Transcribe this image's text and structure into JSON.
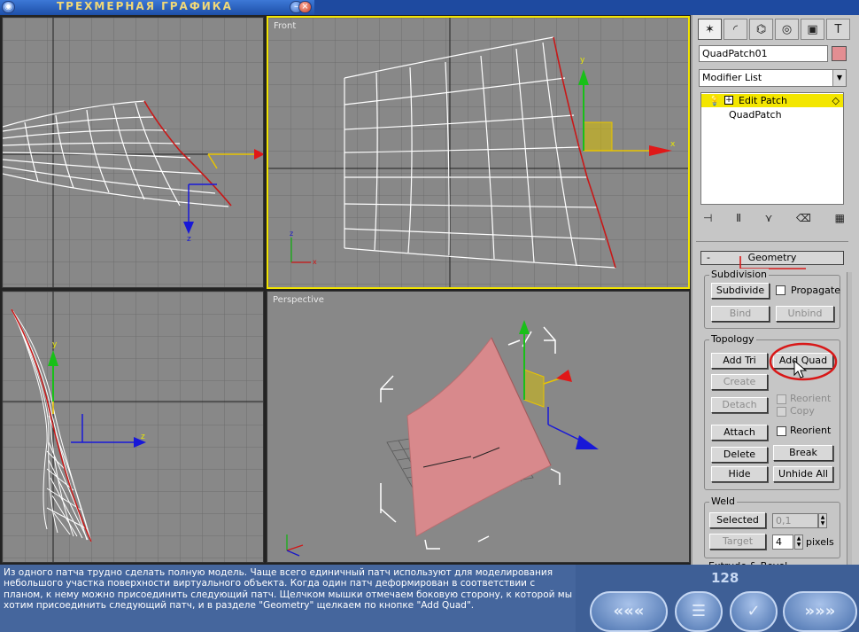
{
  "title_bar": {
    "title": "ТРЕХМЕРНАЯ ГРАФИКА",
    "minimize_label": "–",
    "close_label": "×"
  },
  "viewports": {
    "top_left": {
      "label": ""
    },
    "front": {
      "label": "Front",
      "axis_x": "x",
      "axis_y": "y",
      "axis_z": "z"
    },
    "left": {
      "label": "",
      "axis_y": "y",
      "axis_z": "z"
    },
    "perspective": {
      "label": "Perspective"
    }
  },
  "command_panel": {
    "tabs": [
      {
        "icon": "create-icon",
        "glyph": "✶"
      },
      {
        "icon": "modify-icon",
        "glyph": "◜"
      },
      {
        "icon": "hierarchy-icon",
        "glyph": "⌬"
      },
      {
        "icon": "motion-icon",
        "glyph": "◎"
      },
      {
        "icon": "display-icon",
        "glyph": "▣"
      },
      {
        "icon": "utilities-icon",
        "glyph": "T"
      }
    ],
    "object_name": "QuadPatch01",
    "object_color": "#e38e92",
    "modifier_list": "Modifier List",
    "stack": {
      "edit_patch": "Edit Patch",
      "quadpatch": "QuadPatch"
    },
    "stack_icons": [
      "pin-stack-icon",
      "show-end-result-icon",
      "make-unique-icon",
      "remove-modifier-icon",
      "configure-sets-icon"
    ],
    "geometry": {
      "header": "Geometry",
      "collapse": "-",
      "subdivision": {
        "label": "Subdivision",
        "subdivide": "Subdivide",
        "propagate": "Propagate",
        "bind": "Bind",
        "unbind": "Unbind"
      },
      "topology": {
        "label": "Topology",
        "add_tri": "Add Tri",
        "add_quad": "Add Quad",
        "create": "Create",
        "reorient_dis": "Reorient",
        "copy": "Copy",
        "detach": "Detach",
        "attach": "Attach",
        "reorient": "Reorient",
        "delete": "Delete",
        "break": "Break",
        "hide": "Hide",
        "unhide_all": "Unhide All"
      },
      "weld": {
        "label": "Weld",
        "selected": "Selected",
        "threshold": "0,1",
        "target": "Target",
        "pixels_value": "4",
        "pixels": "pixels"
      },
      "extrude_bevel": "Extrude & Bevel"
    }
  },
  "bottom": {
    "description": "Из одного патча трудно сделать полную модель. Чаще всего единичный патч используют для моделирования небольшого участка поверхности виртуального объекта. Когда один патч деформирован в соответствии с планом, к нему можно присоединить следующий патч. Щелчком мышки отмечаем боковую сторону, к которой мы хотим присоединить следующий патч, и в разделе \"Geometry\" щелкаем по кнопке \"Add Quad\".",
    "page_number": "128",
    "nav": {
      "back": "«««",
      "menu": "☰",
      "check": "✓",
      "forward": "»»»"
    }
  },
  "colors": {
    "active_viewport": "#f2e400",
    "highlight_circle": "#d81818",
    "patch_fill": "#d8898c"
  }
}
